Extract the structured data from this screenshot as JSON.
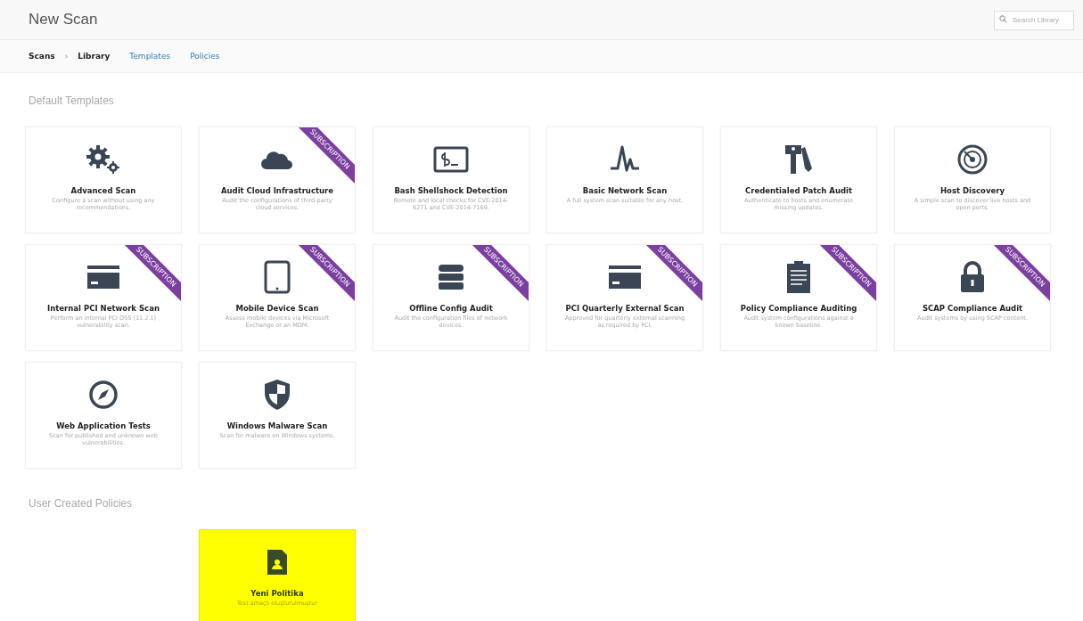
{
  "header": {
    "title": "New Scan",
    "search": {
      "placeholder": "Search Library"
    }
  },
  "nav": {
    "breadcrumb": [
      "Scans",
      "Library"
    ],
    "separator": "›",
    "links": [
      "Templates",
      "Policies"
    ]
  },
  "default_templates": {
    "title": "Default Templates",
    "cards": [
      {
        "name": "Advanced Scan",
        "description": "Configure a scan without using any recommendations."
      },
      {
        "name": "Audit Cloud Infrastructure",
        "description": "Audit the configurations of third-party cloud services.",
        "ribbon": "SUBSCRIPTION"
      },
      {
        "name": "Bash Shellshock Detection",
        "description": "Remote and local checks for CVE-2014-6271 and CVE-2014-7169."
      },
      {
        "name": "Basic Network Scan",
        "description": "A full system scan suitable for any host."
      },
      {
        "name": "Credentialed Patch Audit",
        "description": "Authenticate to hosts and enumerate missing updates."
      },
      {
        "name": "Host Discovery",
        "description": "A simple scan to discover live hosts and open ports."
      },
      {
        "name": "Internal PCI Network Scan",
        "description": "Perform an internal PCI DSS (11.2.1) vulnerability scan.",
        "ribbon": "SUBSCRIPTION"
      },
      {
        "name": "Mobile Device Scan",
        "description": "Assess mobile devices via Microsoft Exchange or an MDM.",
        "ribbon": "SUBSCRIPTION"
      },
      {
        "name": "Offline Config Audit",
        "description": "Audit the configuration files of network devices.",
        "ribbon": "SUBSCRIPTION"
      },
      {
        "name": "PCI Quarterly External Scan",
        "description": "Approved for quarterly external scanning as required by PCI.",
        "ribbon": "SUBSCRIPTION"
      },
      {
        "name": "Policy Compliance Auditing",
        "description": "Audit system configurations against a known baseline.",
        "ribbon": "SUBSCRIPTION"
      },
      {
        "name": "SCAP Compliance Audit",
        "description": "Audit systems by using SCAP content.",
        "ribbon": "SUBSCRIPTION"
      },
      {
        "name": "Web Application Tests",
        "description": "Scan for published and unknown web vulnerabilities."
      },
      {
        "name": "Windows Malware Scan",
        "description": "Scan for malware on Windows systems."
      }
    ]
  },
  "user_policies": {
    "title": "User Created Policies",
    "cards": [
      {
        "name": "Yeni Politika",
        "description": "Test amaçlı oluşturulmuştur",
        "selected": true
      }
    ]
  }
}
